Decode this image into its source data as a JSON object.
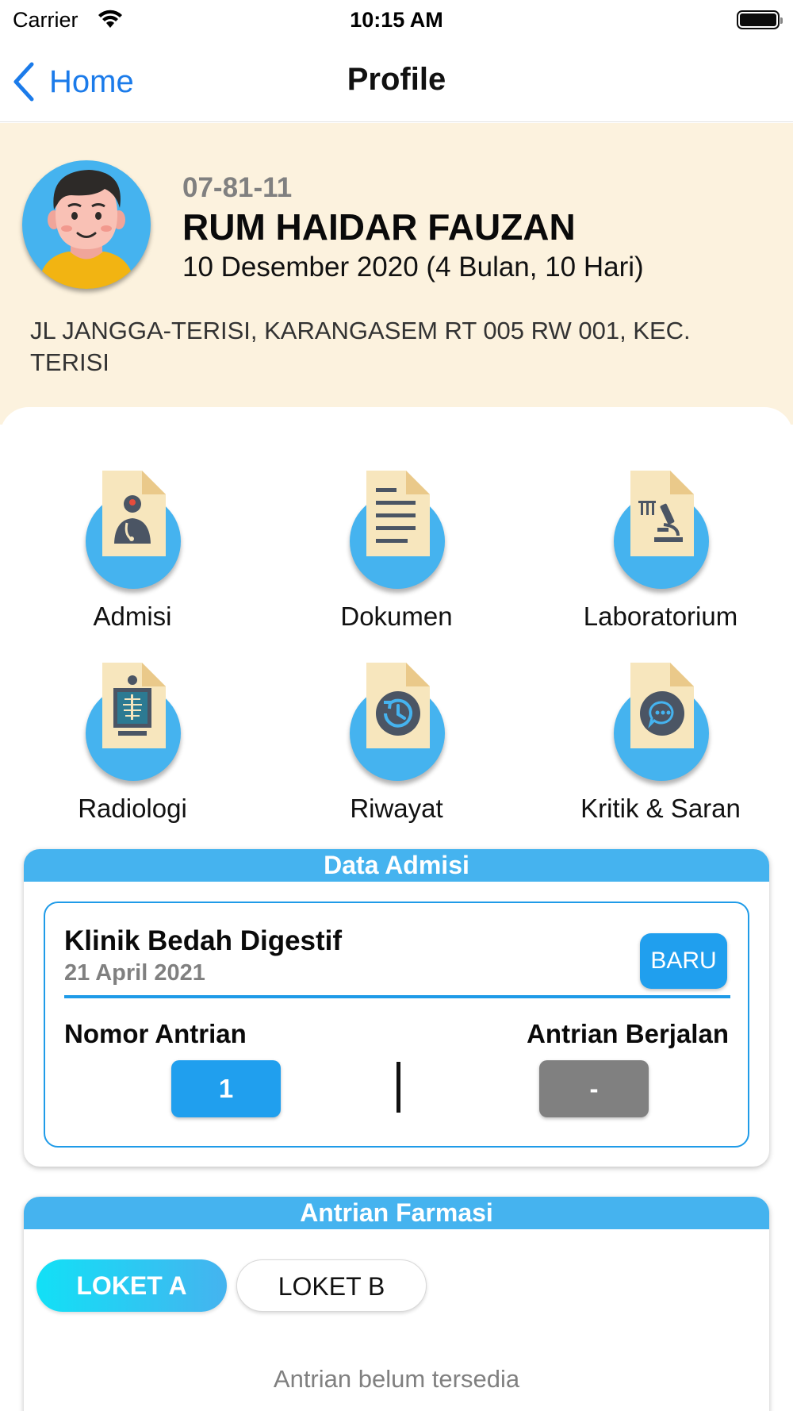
{
  "status_bar": {
    "carrier": "Carrier",
    "time": "10:15 AM",
    "icons": [
      "wifi-icon",
      "battery-icon"
    ]
  },
  "nav": {
    "back_label": "Home",
    "title": "Profile"
  },
  "profile": {
    "id": "07-81-11",
    "name": "RUM HAIDAR FAUZAN",
    "dob": "10 Desember 2020 (4 Bulan, 10 Hari)",
    "address": "JL JANGGA-TERISI, KARANGASEM RT 005 RW 001, KEC. TERISI",
    "avatar_icon": "boy-avatar-icon"
  },
  "menu": [
    {
      "label": "Admisi",
      "icon": "doctor-document-icon"
    },
    {
      "label": "Dokumen",
      "icon": "text-document-icon"
    },
    {
      "label": "Laboratorium",
      "icon": "microscope-document-icon"
    },
    {
      "label": "Radiologi",
      "icon": "xray-document-icon"
    },
    {
      "label": "Riwayat",
      "icon": "history-document-icon"
    },
    {
      "label": "Kritik & Saran",
      "icon": "chat-document-icon"
    }
  ],
  "admisi": {
    "header": "Data Admisi",
    "clinic": "Klinik Bedah Digestif",
    "date": "21 April 2021",
    "status_button": "BARU",
    "queue_label": "Nomor Antrian",
    "queue_value": "1",
    "running_label": "Antrian Berjalan",
    "running_value": "-"
  },
  "farmasi": {
    "header": "Antrian Farmasi",
    "tabs": [
      "LOKET A",
      "LOKET B"
    ],
    "active_tab": "LOKET A",
    "empty_message": "Antrian belum tersedia"
  },
  "colors": {
    "accent": "#1b7bea",
    "header_blue": "#45b3ef",
    "button_blue": "#209fee",
    "profile_bg": "#fcf2de",
    "doc_paper": "#f7e6bd",
    "doc_icon": "#4b5564"
  }
}
